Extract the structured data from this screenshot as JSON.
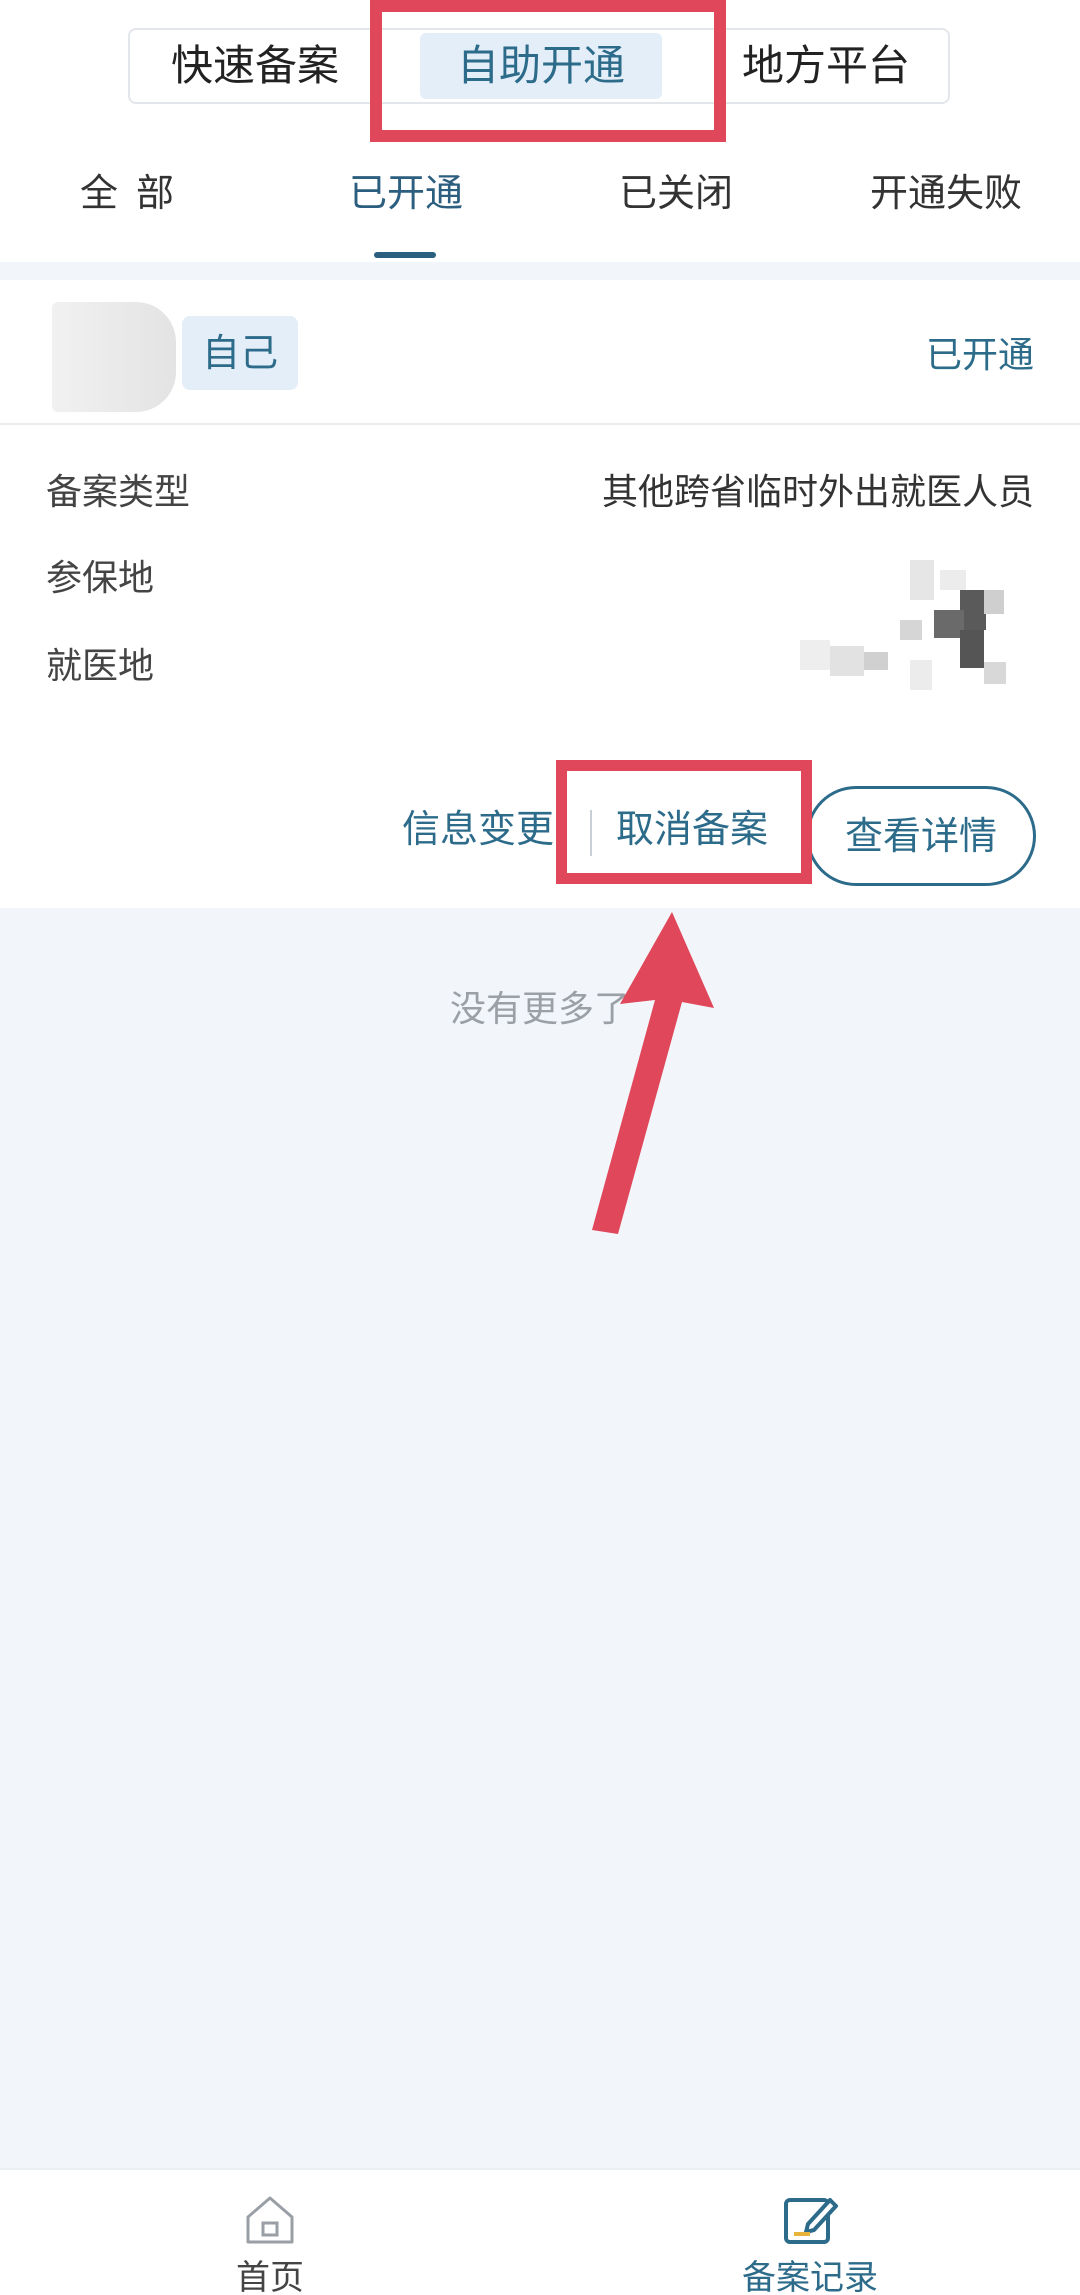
{
  "segmented": {
    "options": [
      "快速备案",
      "自助开通",
      "地方平台"
    ],
    "selected_index": 1
  },
  "tabs": {
    "items": [
      "全部",
      "已开通",
      "已关闭",
      "开通失败"
    ],
    "active_index": 1
  },
  "card": {
    "tag": "自己",
    "status": "已开通",
    "rows": [
      {
        "label": "备案类型",
        "value": "其他跨省临时外出就医人员"
      },
      {
        "label": "参保地",
        "value": ""
      },
      {
        "label": "就医地",
        "value": ""
      }
    ],
    "actions": {
      "change": "信息变更",
      "cancel": "取消备案",
      "detail": "查看详情"
    }
  },
  "list_end_text": "没有更多了",
  "bottom_nav": {
    "home": "首页",
    "records": "备案记录"
  },
  "colors": {
    "accent": "#2c6b8a",
    "highlight": "#e0475a",
    "background": "#f2f5f9"
  },
  "icons": [
    "home-icon",
    "edit-record-icon",
    "red-arrow"
  ]
}
